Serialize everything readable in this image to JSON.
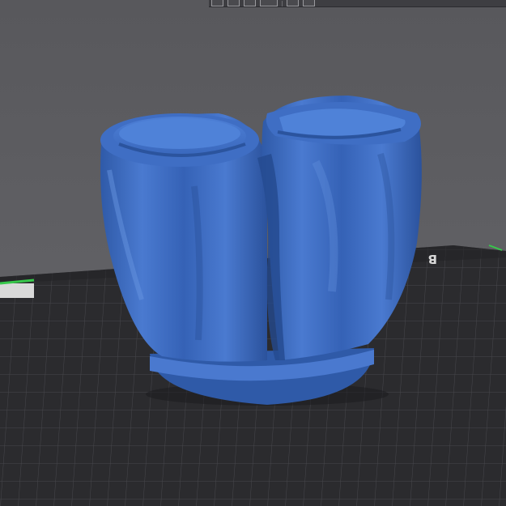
{
  "app": {
    "bed_label": "B",
    "colors": {
      "background": "#5d5d61",
      "bed": "#2b2b2e",
      "grid_line": "#4a4a4f",
      "model": "#3c6bc0",
      "model_shadow": "#25468a",
      "model_highlight": "#5b89d8",
      "axis_x": "#e5433c",
      "axis_y": "#37c84b"
    }
  },
  "toolbar": {
    "tools": [
      "arrange-icon",
      "layout-icon",
      "cut-icon",
      "orient-icon",
      "view-icon",
      "slice-icon"
    ]
  },
  "model": {
    "description_icon": "3d-model"
  }
}
